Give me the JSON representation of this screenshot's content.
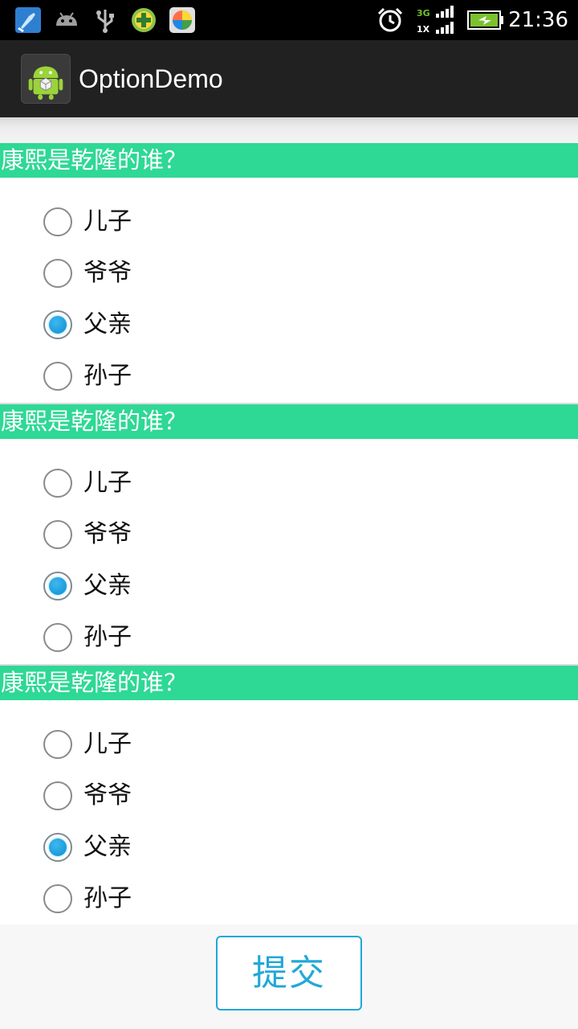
{
  "status_bar": {
    "time": "21:36",
    "left_icons": [
      "cleaner-icon",
      "android-debug-icon",
      "usb-icon",
      "game-plus-icon",
      "app-market-icon"
    ],
    "right_icons": [
      "alarm-icon",
      "signal-3g-icon",
      "battery-charging-icon"
    ],
    "network_top": "3G",
    "network_bottom": "1X"
  },
  "action_bar": {
    "title": "OptionDemo",
    "icon": "android-app-icon"
  },
  "questions": [
    {
      "text": "康熙是乾隆的谁？",
      "options": [
        {
          "label": "儿子",
          "checked": false
        },
        {
          "label": "爷爷",
          "checked": false
        },
        {
          "label": "父亲",
          "checked": true
        },
        {
          "label": "孙子",
          "checked": false
        }
      ]
    },
    {
      "text": "康熙是乾隆的谁？",
      "options": [
        {
          "label": "儿子",
          "checked": false
        },
        {
          "label": "爷爷",
          "checked": false
        },
        {
          "label": "父亲",
          "checked": true
        },
        {
          "label": "孙子",
          "checked": false
        }
      ]
    },
    {
      "text": "康熙是乾隆的谁？",
      "options": [
        {
          "label": "儿子",
          "checked": false
        },
        {
          "label": "爷爷",
          "checked": false
        },
        {
          "label": "父亲",
          "checked": true
        },
        {
          "label": "孙子",
          "checked": false
        }
      ]
    }
  ],
  "submit_label": "提交",
  "colors": {
    "header_bg": "#2ed895",
    "accent": "#21a8d6",
    "action_bar_bg": "#212121"
  }
}
